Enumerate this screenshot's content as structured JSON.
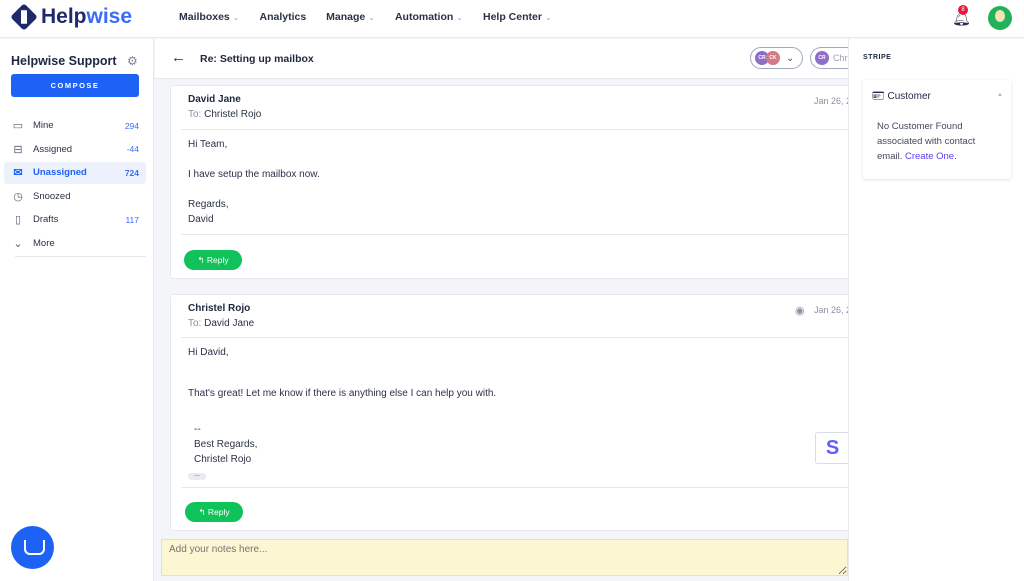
{
  "brand": {
    "name_a": "Help",
    "name_b": "wise"
  },
  "nav": [
    {
      "label": "Mailboxes",
      "dropdown": true
    },
    {
      "label": "Analytics",
      "dropdown": false
    },
    {
      "label": "Manage",
      "dropdown": true
    },
    {
      "label": "Automation",
      "dropdown": true
    },
    {
      "label": "Help Center",
      "dropdown": true
    }
  ],
  "notifications": {
    "count": "8"
  },
  "sidebar": {
    "title": "Helpwise Support",
    "compose": "COMPOSE",
    "items": [
      {
        "label": "Mine",
        "count": "294",
        "icon": "monitor-icon"
      },
      {
        "label": "Assigned",
        "count": "-44",
        "icon": "inbox-icon"
      },
      {
        "label": "Unassigned",
        "count": "724",
        "icon": "open-envelope-icon",
        "active": true
      },
      {
        "label": "Snoozed",
        "count": "",
        "icon": "clock-icon"
      },
      {
        "label": "Drafts",
        "count": "117",
        "icon": "file-icon"
      },
      {
        "label": "More",
        "count": "",
        "icon": "chevron-down-icon"
      }
    ]
  },
  "conversation": {
    "subject": "Re: Setting up mailbox",
    "assignees": [
      "CR",
      "CK"
    ],
    "assignee_pill": {
      "initials": "CR",
      "name": "Chr"
    },
    "messages": [
      {
        "from": "David Jane",
        "to_label": "To:",
        "to": "Christel Rojo",
        "date": "Jan 26, 2",
        "lines": [
          "Hi Team,",
          "I have setup the mailbox now.",
          "Regards,",
          "David"
        ],
        "reply": "Reply"
      },
      {
        "from": "Christel Rojo",
        "to_label": "To:",
        "to": "David Jane",
        "date": "Jan 26, 2",
        "lines": [
          "Hi David,",
          "That's great! Let me know if there is anything else I can help you with.",
          "--",
          "Best Regards,",
          "Christel Rojo"
        ],
        "reply": "Reply"
      }
    ]
  },
  "notes": {
    "placeholder": "Add your notes here..."
  },
  "stripe": {
    "heading": "STRIPE",
    "section": "Customer",
    "message": "No Customer Found associated with contact email.",
    "link": "Create One.",
    "badge": "S"
  },
  "colors": {
    "primary": "#1e62f5",
    "reply": "#10c25a",
    "stripe": "#635bff",
    "notes_bg": "#fdf6d3"
  }
}
